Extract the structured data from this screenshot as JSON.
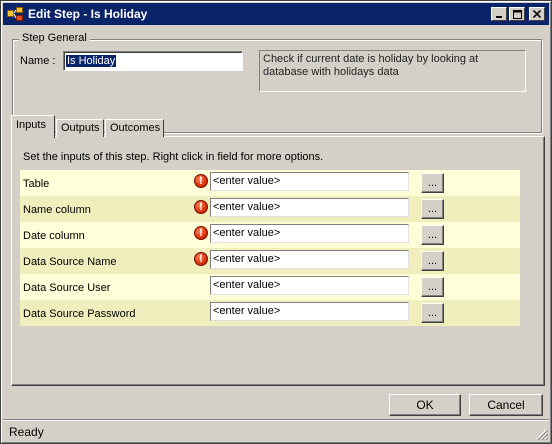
{
  "window": {
    "title": "Edit Step - Is Holiday",
    "icon": "workflow-step-icon"
  },
  "step_general": {
    "group_label": "Step General",
    "name_label": "Name :",
    "name_value": "Is Holiday",
    "description": "Check if current date is holiday by looking at database with holidays data"
  },
  "tabs": [
    {
      "label": "Inputs",
      "active": true
    },
    {
      "label": "Outputs",
      "active": false
    },
    {
      "label": "Outcomes",
      "active": false
    }
  ],
  "inputs_panel": {
    "hint": "Set the inputs of this step.  Right click in field for more options.",
    "browse_label": "...",
    "rows": [
      {
        "label": "Table",
        "value": "<enter value>",
        "required": true
      },
      {
        "label": "Name column",
        "value": "<enter value>",
        "required": true
      },
      {
        "label": "Date column",
        "value": "<enter value>",
        "required": true
      },
      {
        "label": "Data Source Name",
        "value": "<enter value>",
        "required": true
      },
      {
        "label": "Data Source User",
        "value": "<enter value>",
        "required": false
      },
      {
        "label": "Data Source Password",
        "value": "<enter value>",
        "required": false
      }
    ]
  },
  "buttons": {
    "ok": "OK",
    "cancel": "Cancel"
  },
  "status": {
    "text": "Ready"
  },
  "colors": {
    "titlebar": "#0a246a",
    "row_light": "#fefed8",
    "row_dark": "#f0eebc",
    "warning": "#d9300a"
  }
}
